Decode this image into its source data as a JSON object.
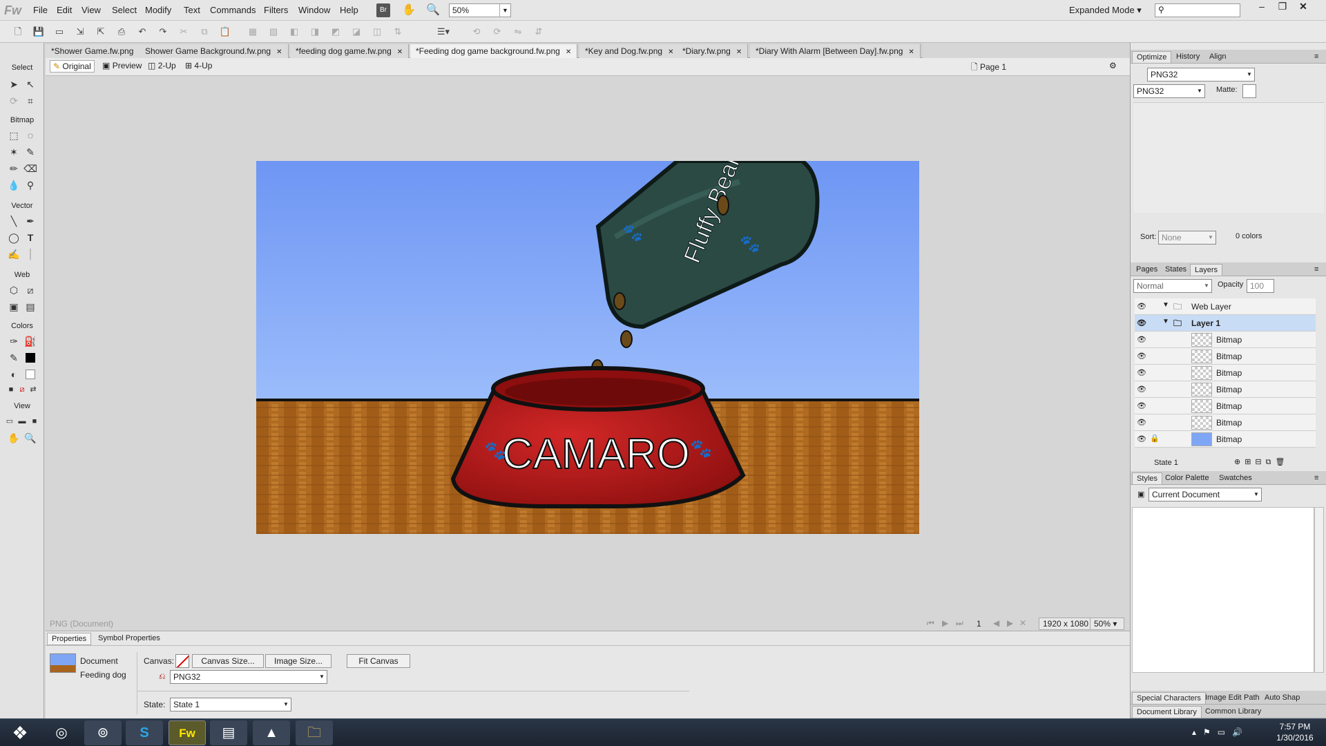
{
  "app": {
    "logo": "Fw"
  },
  "menu": [
    "File",
    "Edit",
    "View",
    "Select",
    "Modify",
    "Text",
    "Commands",
    "Filters",
    "Window",
    "Help"
  ],
  "zoom": "50%",
  "expanded_mode": "Expanded Mode",
  "bridge_label": "Br",
  "tabs": [
    {
      "label": "*Shower Game.fw.png",
      "active": false
    },
    {
      "label": "Shower Game Background.fw.png",
      "active": false
    },
    {
      "label": "*feeding dog game.fw.png",
      "active": false
    },
    {
      "label": "*Feeding dog game background.fw.png",
      "active": true
    },
    {
      "label": "*Key and Dog.fw.png",
      "active": false
    },
    {
      "label": "*Diary.fw.png",
      "active": false
    },
    {
      "label": "*Diary With Alarm [Between Day].fw.png",
      "active": false
    }
  ],
  "view_modes": [
    "Original",
    "Preview",
    "2-Up",
    "4-Up"
  ],
  "page_label": "Page 1",
  "left_sections": [
    "Select",
    "Bitmap",
    "Vector",
    "Web",
    "Colors",
    "View"
  ],
  "canvas": {
    "bag_text": "Fluffy Beans",
    "bowl_text": "CAMARO",
    "sky_color": "#7fa6f5",
    "floor_color": "#a9651f",
    "bowl_color": "#b01818",
    "bag_color": "#2b4a44"
  },
  "status": {
    "doc_type": "PNG (Document)",
    "frame": "1",
    "size": "1920 x 1080",
    "zoom": "50%"
  },
  "properties": {
    "tabs": [
      "Properties",
      "Symbol Properties"
    ],
    "doc_label": "Document",
    "doc_name": "Feeding dog",
    "canvas_label": "Canvas:",
    "canvas_size_btn": "Canvas Size...",
    "image_size_btn": "Image Size...",
    "fit_canvas_btn": "Fit Canvas",
    "format": "PNG32",
    "state_label": "State:",
    "state_value": "State 1"
  },
  "right": {
    "optimize_tabs": [
      "Optimize",
      "History",
      "Align"
    ],
    "format_top": "PNG32",
    "format": "PNG32",
    "matte_label": "Matte:",
    "sort_label": "Sort:",
    "sort_value": "None",
    "colors_count": "0 colors",
    "layer_tabs": [
      "Pages",
      "States",
      "Layers"
    ],
    "blend": "Normal",
    "opacity_label": "Opacity",
    "opacity_value": "100",
    "layers": [
      {
        "name": "Web Layer",
        "type": "folder"
      },
      {
        "name": "Layer 1",
        "type": "folder",
        "selected": true
      },
      {
        "name": "Bitmap"
      },
      {
        "name": "Bitmap"
      },
      {
        "name": "Bitmap"
      },
      {
        "name": "Bitmap"
      },
      {
        "name": "Bitmap"
      },
      {
        "name": "Bitmap"
      },
      {
        "name": "Bitmap"
      }
    ],
    "state_footer": "State 1",
    "style_tabs": [
      "Styles",
      "Color Palette",
      "Swatches"
    ],
    "styles_select": "Current Document",
    "bottom_tabs": [
      "Special Characters",
      "Image Edit",
      "Path",
      "Auto Shap"
    ],
    "bottom_tabs2": [
      "Document Library",
      "Common Library"
    ]
  },
  "taskbar": {
    "time": "7:57 PM",
    "date": "1/30/2016",
    "apps": [
      "chrome-icon",
      "skype-icon",
      "fireworks-icon",
      "winrar-icon",
      "aim-icon",
      "folder-icon"
    ],
    "fw_label": "Fw"
  }
}
